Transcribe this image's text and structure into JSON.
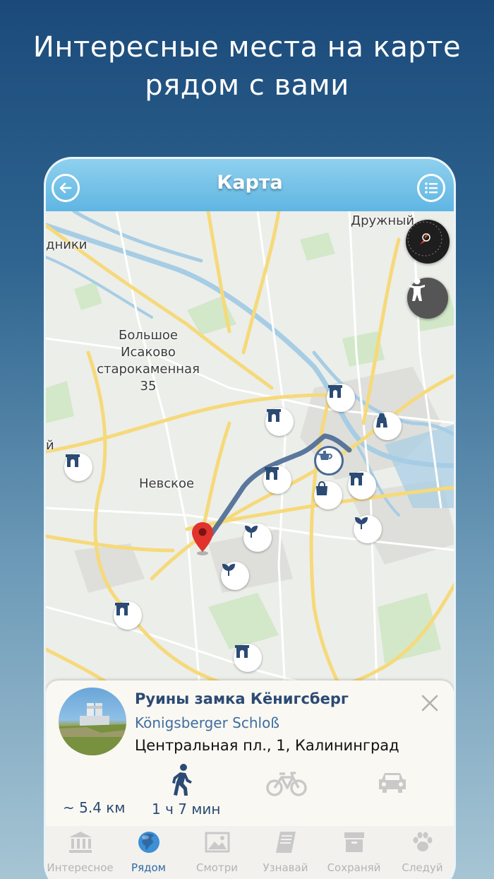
{
  "headline": {
    "line1": "Интересные места на карте",
    "line2": "рядом с вами"
  },
  "appbar": {
    "title": "Карта",
    "back_icon": "back-arrow-icon",
    "menu_icon": "list-menu-icon",
    "color": "#6cbde6"
  },
  "map": {
    "labels": {
      "druzhny": "Дружный",
      "dniki": "дники",
      "bolshoe": "Большое",
      "isakovo": "Исаково",
      "starokamennaya": "старокаменная",
      "num35": "35",
      "nevskoe": "Невское",
      "y_edge": "й"
    },
    "route_color": "#4a6994",
    "pin_color": "#e0332e"
  },
  "card": {
    "title": "Руины замка Кёнигсберг",
    "subtitle": "Königsberger Schloß",
    "address": "Центральная пл., 1, Калининград",
    "distance": "~ 5.4 км",
    "walk_time": "1 ч 7 мин",
    "modes": [
      "walk-icon",
      "bicycle-icon",
      "car-icon"
    ]
  },
  "tabs": [
    {
      "label": "Интересное",
      "icon": "museum-icon",
      "active": false
    },
    {
      "label": "Рядом",
      "icon": "globe-icon",
      "active": true
    },
    {
      "label": "Смотри",
      "icon": "picture-icon",
      "active": false
    },
    {
      "label": "Узнавай",
      "icon": "book-icon",
      "active": false
    },
    {
      "label": "Сохраняй",
      "icon": "archive-icon",
      "active": false
    },
    {
      "label": "Следуй",
      "icon": "paw-icon",
      "active": false
    }
  ],
  "colors": {
    "accent": "#2f6aa3",
    "dark_text": "#2b4a74"
  }
}
